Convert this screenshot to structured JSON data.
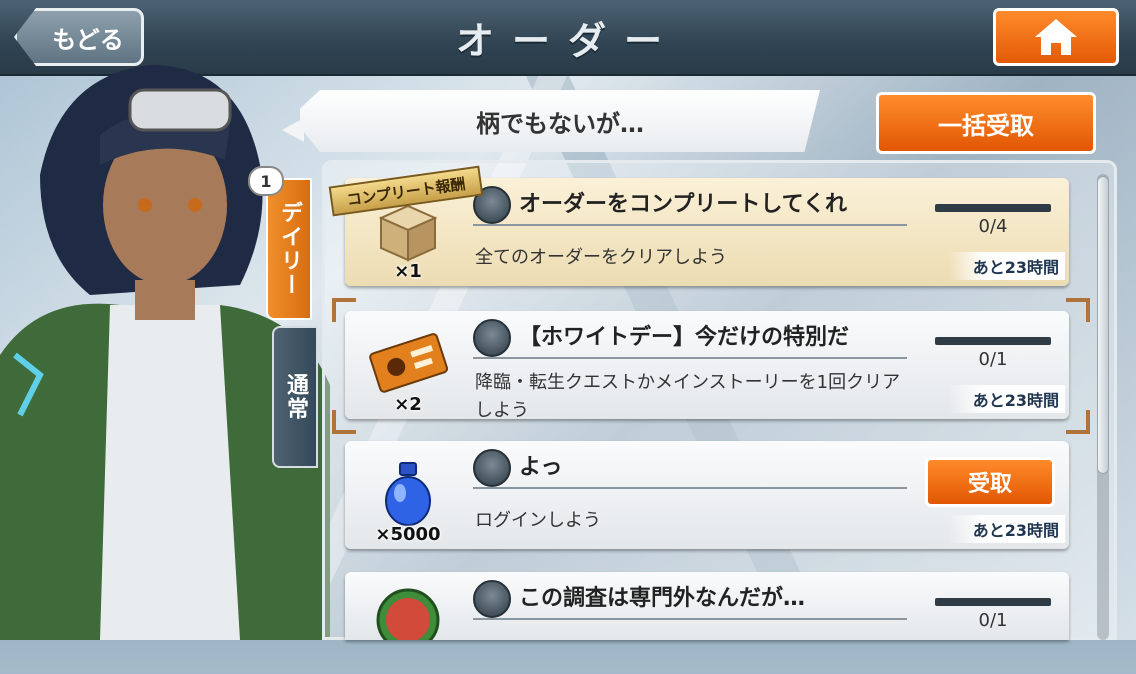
{
  "header": {
    "back_label": "もどる",
    "title": "オーダー",
    "home_icon": "home-icon"
  },
  "speech_bubble": {
    "text": "柄でもないが…"
  },
  "bulk_receive_label": "一括受取",
  "tabs": [
    {
      "label": "デイリー",
      "badge": "1",
      "active": true
    },
    {
      "label": "通常",
      "active": false
    }
  ],
  "complete_ribbon": "コンプリート報酬",
  "orders": [
    {
      "title": "オーダーをコンプリートしてくれ",
      "desc": "全てのオーダーをクリアしよう",
      "reward_icon": "box-icon",
      "reward_count": "×1",
      "progress_text": "0/4",
      "progress": 0,
      "time_left": "あと23時間"
    },
    {
      "title": "【ホワイトデー】今だけの特別だ",
      "desc": "降臨・転生クエストかメインストーリーを1回クリアしよう",
      "reward_icon": "ticket-icon",
      "reward_count": "×2",
      "progress_text": "0/1",
      "progress": 0,
      "time_left": "あと23時間"
    },
    {
      "title": "よっ",
      "desc": "ログインしよう",
      "reward_icon": "potion-icon",
      "reward_count": "×5000",
      "receive_label": "受取",
      "time_left": "あと23時間"
    },
    {
      "title": "この調査は専門外なんだが…",
      "reward_icon": "character-medal-icon",
      "progress_text": "0/1",
      "progress": 0
    }
  ],
  "colors": {
    "accent_orange": "#f07a1a",
    "header_dark": "#2f4352"
  }
}
